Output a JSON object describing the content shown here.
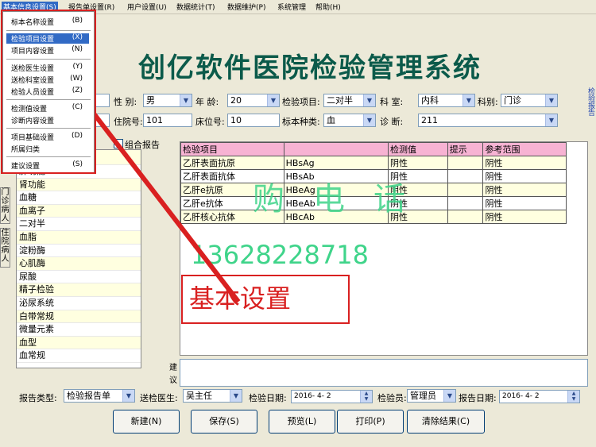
{
  "menubar": {
    "items": [
      "基本信息设置(S)",
      "报告单设置(R)",
      "用户设置(U)",
      "数据统计(T)",
      "数据维护(P)",
      "系统管理",
      "帮助(H)"
    ]
  },
  "dropdown": {
    "items": [
      {
        "label": "标本名称设置",
        "key": "(B)"
      },
      {
        "label": "检验项目设置",
        "key": "(X)"
      },
      {
        "label": "项目内容设置",
        "key": "(N)"
      },
      {
        "label": "送检医生设置",
        "key": "(Y)"
      },
      {
        "label": "送检科室设置",
        "key": "(W)"
      },
      {
        "label": "检验人员设置",
        "key": "(Z)"
      },
      {
        "label": "检测值设置",
        "key": "(C)"
      },
      {
        "label": "诊断内容设置",
        "key": ""
      },
      {
        "label": "项目基础设置",
        "key": "(D)"
      },
      {
        "label": "所属归类",
        "key": ""
      },
      {
        "label": "建议设置",
        "key": "(S)"
      }
    ]
  },
  "title": "创亿软件医院检验管理系统",
  "right_edge_text": "检验报告",
  "form": {
    "gender_label": "性 别:",
    "gender_value": "男",
    "age_label": "年 龄:",
    "age_value": "20",
    "item_label": "检验项目:",
    "item_value": "二对半",
    "dept_label": "科 室:",
    "dept_value": "内科",
    "category_label": "科别:",
    "category_value": "门诊",
    "inpatient_label": "住院号:",
    "inpatient_value": "101",
    "bed_label": "床位号:",
    "bed_value": "10",
    "specimen_label": "标本种类:",
    "specimen_value": "血",
    "diagnosis_label": "诊 断:",
    "diagnosis_value": "211",
    "combined_report": "组合报告"
  },
  "side_tabs": [
    "门诊病人",
    "住院病人"
  ],
  "left_list": [
    "肝功能",
    "肾功能",
    "血糖",
    "血离子",
    "二对半",
    "血脂",
    "淀粉酶",
    "心肌酶",
    "尿酸",
    "精子检验",
    "泌尿系统",
    "白带常规",
    "微量元素",
    "血型",
    "血常规"
  ],
  "grid": {
    "headers": [
      "检验项目",
      "",
      "检测值",
      "提示",
      "参考范围"
    ],
    "rows": [
      [
        "乙肝表面抗原",
        "HBsAg",
        "阴性",
        "",
        "阴性"
      ],
      [
        "乙肝表面抗体",
        "HBsAb",
        "阴性",
        "",
        "阴性"
      ],
      [
        "乙肝e抗原",
        "HBeAg",
        "阴性",
        "",
        "阴性"
      ],
      [
        "乙肝e抗体",
        "HBeAb",
        "阴性",
        "",
        "阴性"
      ],
      [
        "乙肝核心抗体",
        "HBcAb",
        "阴性",
        "",
        "阴性"
      ]
    ]
  },
  "remarks_label": "建议",
  "bottom": {
    "report_type_label": "报告类型:",
    "report_type_value": "检验报告单",
    "doctor_label": "送检医生:",
    "doctor_value": "吴主任",
    "date_label": "检验日期:",
    "date_value": "2016- 4- 2",
    "checker_label": "检验员:",
    "checker_value": "管理员",
    "report_date_label": "报告日期:",
    "report_date_value": "2016- 4- 2"
  },
  "buttons": [
    "新建(N)",
    "保存(S)",
    "预览(L)",
    "打印(P)",
    "清除结果(C)"
  ],
  "overlay": {
    "watermark": "购电话",
    "phone": "13628228718",
    "callout": "基本设置"
  },
  "colors": {
    "callout": "#d92020",
    "watermark": "#3fd48a",
    "header": "#f7b3d3",
    "title": "#0b5a4a"
  }
}
